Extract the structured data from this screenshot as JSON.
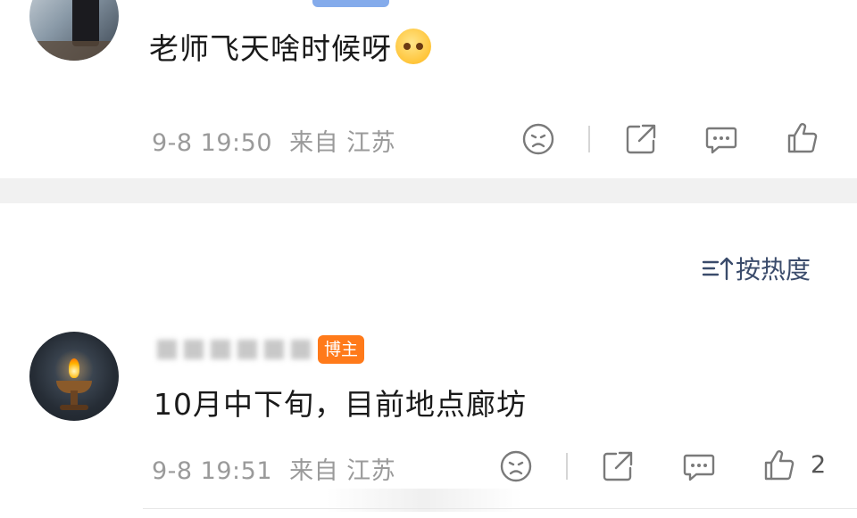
{
  "post1": {
    "comment": "老师飞天啥时候呀",
    "emoji_icon": "pleading-face-emoji",
    "timestamp": "9-8 19:50",
    "location": "来自 江苏"
  },
  "sort": {
    "label": "按热度"
  },
  "post2": {
    "badge": "博主",
    "comment": "10月中下旬，目前地点廊坊",
    "timestamp": "9-8 19:51",
    "location": "来自 江苏",
    "like_count": "2"
  },
  "colors": {
    "sort_text": "#3a4b6b",
    "host_badge": "#ff7a1a",
    "meta_text": "#9a9a9a",
    "divider_band": "#f1f1f1"
  }
}
